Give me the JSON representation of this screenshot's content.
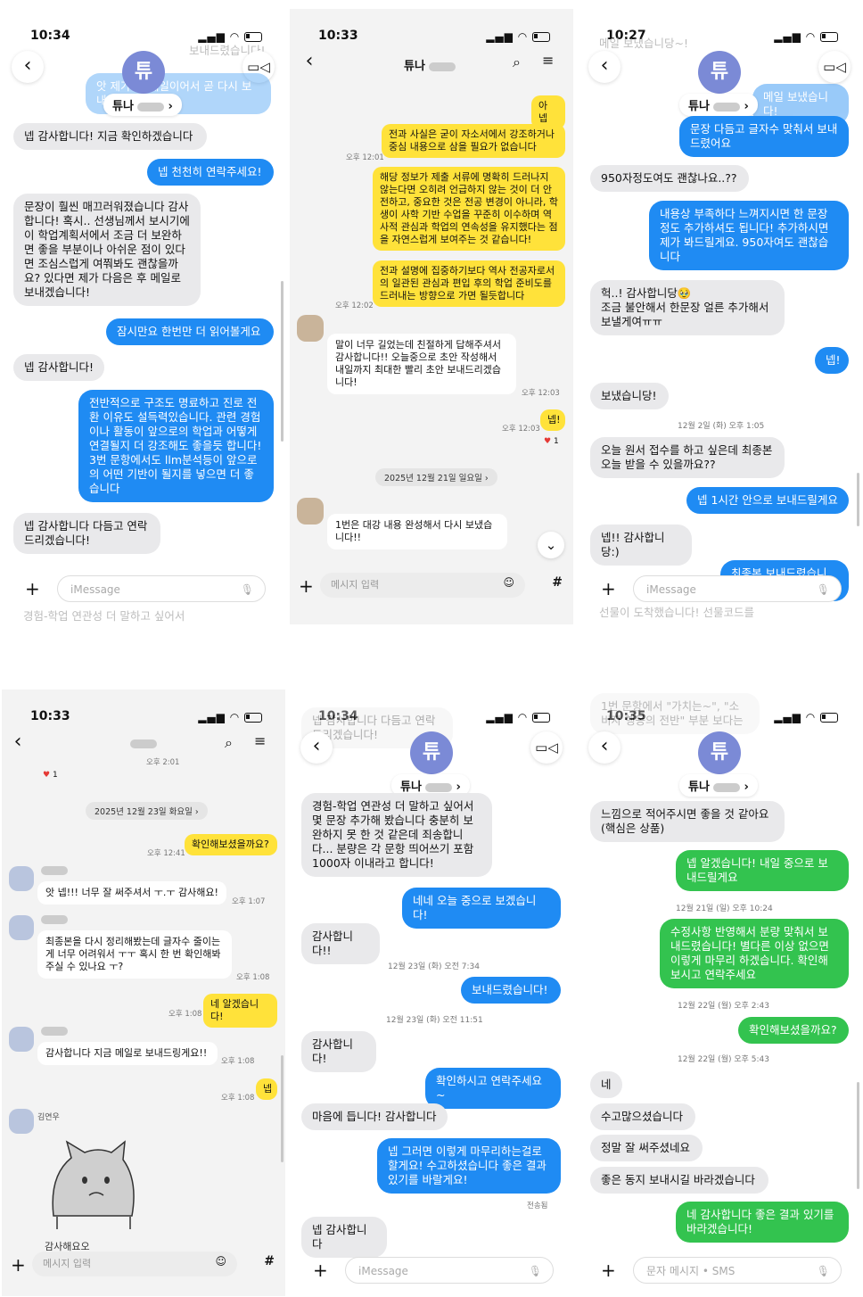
{
  "status": {
    "p1_time": "10:34",
    "p2_time": "10:33",
    "p3_time": "10:27",
    "p4_time": "10:33",
    "p5_time": "10:34",
    "p6_time": "10:35"
  },
  "contact": {
    "avatar_letter": "튜",
    "name": "튜나"
  },
  "input": {
    "imessage": "iMessage",
    "kakao": "메시지 입력",
    "sms": "문자 메시지 • SMS"
  },
  "p1": {
    "ghost_top": "보내드렸습니다!",
    "ghost_out": "앗 제가 … 메일이어서 곧 다시 보내드",
    "in1": "넵 감사합니다! 지금 확인하겠습니다",
    "out1": "넵 천천히 연락주세요!",
    "in2": "문장이 훨씬 매끄러워졌습니다 감사합니다! 혹시.. 선생님께서 보시기에 이 학업계획서에서 조금 더 보완하면 좋을 부분이나 아쉬운 점이 있다면 조심스럽게 여쭤봐도 괜찮을까요? 있다면 제가 다음은 후 메일로 보내겠습니다!",
    "out2": "잠시만요 한번만 더 읽어볼게요",
    "in3": "넵 감사합니다!",
    "out3": "전반적으로 구조도 명료하고 진로 전환 이유도 설득력있습니다. 관련 경험이나 활동이 앞으로의 학업과 어떻게 연결될지 더 강조해도 좋을듯 합니다! 3번 문항에서도 llm분석등이 앞으로의 어떤 기반이 될지를 넣으면 더 좋습니다",
    "in4": "넵 감사합니다 다듬고 연락 드리겠습니다!",
    "ghost_bottom": "경험-학업 연관성 더 말하고 싶어서"
  },
  "p2": {
    "out1": "아 넵",
    "out2": "전과 사실은 굳이 자소서에서 강조하거나 중심 내용으로 삼을 필요가 없습니다",
    "time1": "오후 12:01",
    "out3": "해당 정보가 제출 서류에 명확히 드러나지 않는다면 오히려 언급하지 않는 것이 더 안전하고, 중요한 것은 전공 변경이 아니라, 학생이 사학 기반 수업을 꾸준히 이수하며 역사적 관심과 학업의 연속성을 유지했다는 점을 자연스럽게 보여주는 것 같습니다!",
    "out4": "전과 설명에 집중하기보다 역사 전공자로서의 일관된 관심과 편입 후의 학업 준비도를 드러내는 방향으로 가면 될듯합니다",
    "time2": "오후 12:02",
    "in1": "말이 너무 길었는데 친절하게 답해주셔서 감사합니다!! 오늘중으로 초안 작성해서 내일까지 최대한 빨리 초안 보내드리겠습니다!",
    "time3": "오후 12:03",
    "out5": "넵!",
    "time4": "오후 12:03",
    "heart": "1",
    "date": "2025년 12월 21일 일요일 ›",
    "in2": "1번은 대강 내용 완성해서 다시 보냈습니다!!"
  },
  "p3": {
    "ghost_top": "메일 보냈습니당~!",
    "out0": "메일 보냈습니다!",
    "out1": "문장 다듬고 글자수 맞춰서 보내드렸어요",
    "in1": "950자정도여도 괜찮나요..??",
    "out2": "내용상 부족하다 느껴지시면 한 문장 정도 추가하셔도 됩니다! 추가하시면 제가 봐드릴게요. 950자여도 괜찮습니다",
    "in2": "헉..! 감사합니당🥹\n조금 불안해서 한문장 얼른 추가해서 보낼게여ㅠㅠ",
    "out3": "넵!",
    "in3": "보냈습니당!",
    "date": "12월 2일 (화) 오후 1:05",
    "in4": "오늘 원서 접수를 하고 싶은데 최종본 오늘 받을 수 있을까요??",
    "out4": "넵 1시간 안으로 보내드릴게요",
    "in5": "넵!! 감사합니당:)",
    "out5": "최종본 보내드렸습니다!",
    "ghost_bottom": "선물이 도착했습니다! 선물코드를"
  },
  "p4": {
    "time0": "오후 2:01",
    "heart": "1",
    "date": "2025년 12월 23일 화요일 ›",
    "out1": "확인해보셨을까요?",
    "time1": "오후 12:41",
    "in1": "앗 넵!!! 너무 잘 써주셔서 ㅜ.ㅜ 감사해요!",
    "time2": "오후 1:07",
    "in2": "최종본을 다시 정리해봤는데 글자수 줄이는게 너무 어려워서 ㅜㅜ 혹시 한 번 확인해봐 주실 수 있나요 ㅜ?",
    "time3": "오후 1:08",
    "out2": "네 알겠습니다!",
    "time4": "오후 1:08",
    "in3": "감사합니다 지금 메일로 보내드링게요!!",
    "time5": "오후 1:08",
    "out3": "넵",
    "time6": "오후 1:08",
    "sender2": "김연우",
    "cut": "감사해요오"
  },
  "p5": {
    "ghost_top": "넵 감사합니다 다듬고 연락 드리겠습니다!",
    "in1": "경험-학업 연관성 더 말하고 싶어서 몇 문장 추가해 봤습니다 충분히 보완하지 못 한 것 같은데 죄송합니다... 분량은 각 문항 띄어쓰기 포함 1000자 이내라고 합니다!",
    "out1": "네네 오늘 중으로 보겠습니다!",
    "in2": "감사합니다!!",
    "date1": "12월 23일 (화) 오전 7:34",
    "out2": "보내드렸습니다!",
    "date2": "12월 23일 (화) 오전 11:51",
    "in3": "감사합니다!",
    "out3": "확인하시고 연락주세요~",
    "in4": "마음에 듭니다! 감사합니다",
    "out4": "넵 그러면 이렇게 마무리하는걸로 할게요! 수고하셨습니다 좋은 결과 있기를 바랄게요!",
    "status": "전송됨",
    "in5": "넵 감사합니다"
  },
  "p6": {
    "ghost_top": "1번 문항에서 \"가치는~\", \"소비자 행동의 전반\" 부분 보다는",
    "in1": "느낌으로 적어주시면 좋을 것 같아요 (핵심은 상품)",
    "out1": "넵 알겠습니다! 내일 중으로 보내드릴게요",
    "date1": "12월 21일 (일) 오후 10:24",
    "out2": "수정사항 반영해서 분량 맞춰서 보내드렸습니다! 별다른 이상 없으면 이렇게 마무리 하겠습니다. 확인해보시고 연락주세요",
    "date2": "12월 22일 (월) 오후 2:43",
    "out3": "확인해보셨을까요?",
    "date3": "12월 22일 (월) 오후 5:43",
    "in2": "네",
    "in3": "수고많으셨습니다",
    "in4": "정말 잘 써주셨네요",
    "in5": "좋은 동지 보내시길 바라겠습니다",
    "out4": "네 감사합니다 좋은 결과 있기를 바라겠습니다!"
  },
  "colors": {
    "imessage_blue": "#1f8bf3",
    "sms_green": "#33c34f",
    "kakao_yellow": "#ffe23a",
    "kakao_bg": "#f3f3f3"
  }
}
